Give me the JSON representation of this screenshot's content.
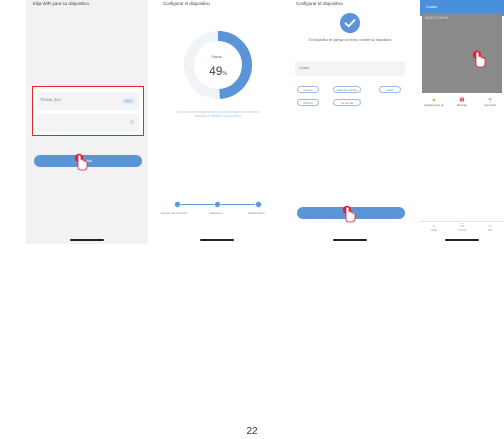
{
  "screen1": {
    "title": "Elija WiFi para su dispositivo",
    "network_name": "TPLINK_5G4",
    "network_badge": "Wi-Fi",
    "password_value": "",
    "button_label": "Listo"
  },
  "screen2": {
    "title": "Configurar el dispositivo",
    "progress_label": "Pasos...",
    "progress_value": "49",
    "progress_unit": "%",
    "progress_fraction": 0.49,
    "hint": "El proceso de emparejamiento puede tardar unos minutos; acerque el teléfono al dispositivo",
    "steps": [
      "Equipo de conexión",
      "Inscribirse",
      "Inicialización"
    ]
  },
  "screen3": {
    "title": "Configurar el dispositivo",
    "success_message": "El dispositivo se agregó con éxito, nombre su dispositivo",
    "name_value": "Cuarto",
    "room_chips": [
      "Cuarto",
      "Sala de estudio",
      "Sala",
      "Oficina",
      "La tienda"
    ],
    "button_label": "Listo"
  },
  "screen4": {
    "header": "Cuarto",
    "timestamp": "01/02 17:06:09",
    "controls": [
      {
        "icon": "alarm-icon",
        "label": "Apartamento en"
      },
      {
        "icon": "trash-icon",
        "label": "Eliminar"
      },
      {
        "icon": "share-icon",
        "label": "Compartir"
      }
    ],
    "tabs": [
      {
        "icon": "home-icon",
        "label": "Hogar"
      },
      {
        "icon": "cart-icon",
        "label": "Tienda"
      },
      {
        "icon": "user-icon",
        "label": "Mío"
      }
    ]
  },
  "page_number": "22",
  "colors": {
    "accent": "#5b95d8",
    "highlight": "#e0262e",
    "tap": "#d9253a"
  }
}
